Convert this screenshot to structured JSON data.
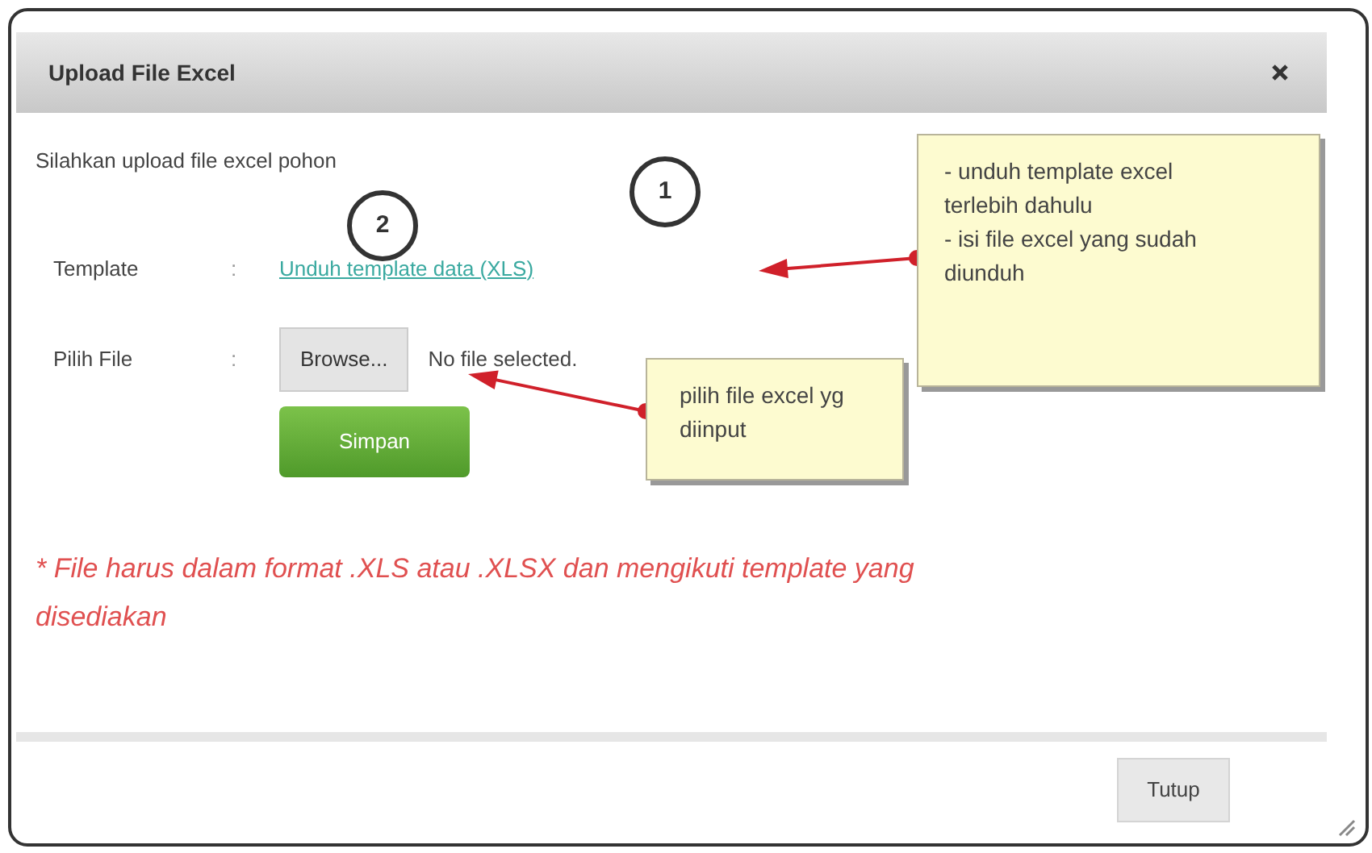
{
  "dialog": {
    "title": "Upload File Excel",
    "intro": "Silahkan upload file excel pohon",
    "fields": [
      {
        "kind": "link",
        "label": "Template",
        "separator": ":",
        "value": "Unduh template data (XLS)"
      },
      {
        "kind": "file",
        "label": "Pilih File",
        "separator": ":",
        "button": "Browse...",
        "value": "No file selected."
      }
    ],
    "submit_button": "Simpan",
    "note": "* File harus dalam format .XLS atau .XLSX dan mengikuti template yang disediakan",
    "footer_button": "Tutup"
  },
  "annotations": [
    {
      "number": "1",
      "lines": [
        "- unduh template excel terlebih dahulu",
        "- isi file excel yang sudah diunduh"
      ]
    },
    {
      "number": "2",
      "lines": [
        "pilih file excel yg diinput"
      ]
    }
  ]
}
